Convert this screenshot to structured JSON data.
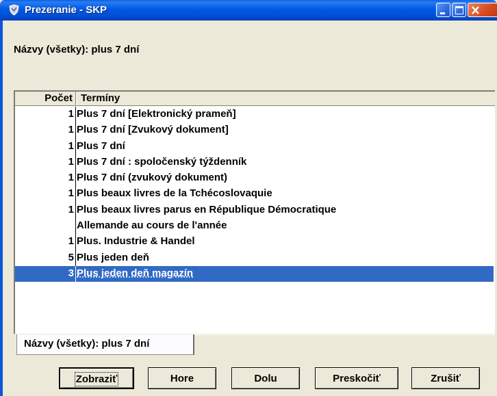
{
  "window": {
    "title": "Prezeranie - SKP",
    "icon": "shield-app-icon",
    "controls": [
      "minimize-icon",
      "maximize-icon",
      "close-icon"
    ]
  },
  "header_label": "Názvy (všetky): plus 7 dní",
  "list": {
    "columns": {
      "count": "Počet",
      "terms": "Termíny"
    },
    "rows": [
      {
        "count": "1",
        "term": "Plus 7 dní [Elektronický prameň]"
      },
      {
        "count": "1",
        "term": "Plus 7 dní [Zvukový dokument]"
      },
      {
        "count": "1",
        "term": "Plus 7 dní"
      },
      {
        "count": "1",
        "term": "Plus 7 dní : spoločenský týždenník"
      },
      {
        "count": "1",
        "term": "Plus 7 dní (zvukový dokument)"
      },
      {
        "count": "1",
        "term": "Plus beaux livres de la Tchécoslovaquie"
      },
      {
        "count": "1",
        "term": "Plus beaux livres parus en République Démocratique"
      },
      {
        "count": "",
        "term": "Allemande au cours de l'année"
      },
      {
        "count": "1",
        "term": "Plus. Industrie & Handel"
      },
      {
        "count": "5",
        "term": "Plus jeden deň"
      },
      {
        "count": "3",
        "term": "Plus jeden deň magazín"
      }
    ],
    "selected_index": 10,
    "selection_color": "#316ac5"
  },
  "tab_label": "Názvy (všetky): plus 7 dní",
  "buttons": {
    "show": "Zobraziť",
    "up": "Hore",
    "down": "Dolu",
    "skip": "Preskočiť",
    "cancel": "Zrušiť"
  }
}
